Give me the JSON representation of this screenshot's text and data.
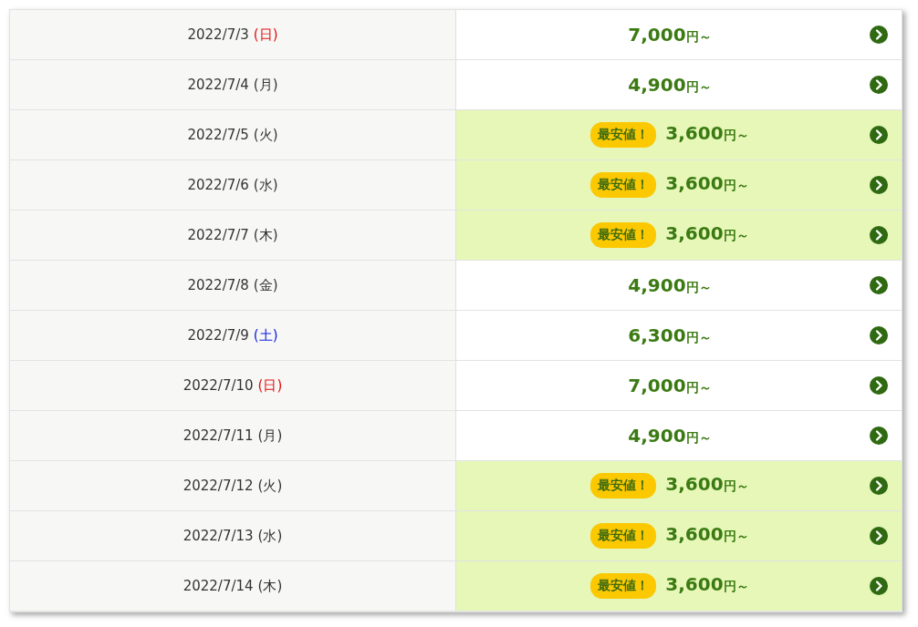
{
  "rows": [
    {
      "date": "2022/7/3",
      "weekday": "(日)",
      "color": "#e01010",
      "cheapest": false,
      "price": "7,000",
      "unit": "円～"
    },
    {
      "date": "2022/7/4",
      "weekday": "(月)",
      "color": "#333333",
      "cheapest": false,
      "price": "4,900",
      "unit": "円～"
    },
    {
      "date": "2022/7/5",
      "weekday": "(火)",
      "color": "#333333",
      "cheapest": true,
      "badge": "最安値！",
      "price": "3,600",
      "unit": "円～"
    },
    {
      "date": "2022/7/6",
      "weekday": "(水)",
      "color": "#333333",
      "cheapest": true,
      "badge": "最安値！",
      "price": "3,600",
      "unit": "円～"
    },
    {
      "date": "2022/7/7",
      "weekday": "(木)",
      "color": "#333333",
      "cheapest": true,
      "badge": "最安値！",
      "price": "3,600",
      "unit": "円～"
    },
    {
      "date": "2022/7/8",
      "weekday": "(金)",
      "color": "#333333",
      "cheapest": false,
      "price": "4,900",
      "unit": "円～"
    },
    {
      "date": "2022/7/9",
      "weekday": "(土)",
      "color": "#1020e0",
      "cheapest": false,
      "price": "6,300",
      "unit": "円～"
    },
    {
      "date": "2022/7/10",
      "weekday": "(日)",
      "color": "#e01010",
      "cheapest": false,
      "price": "7,000",
      "unit": "円～"
    },
    {
      "date": "2022/7/11",
      "weekday": "(月)",
      "color": "#333333",
      "cheapest": false,
      "price": "4,900",
      "unit": "円～"
    },
    {
      "date": "2022/7/12",
      "weekday": "(火)",
      "color": "#333333",
      "cheapest": true,
      "badge": "最安値！",
      "price": "3,600",
      "unit": "円～"
    },
    {
      "date": "2022/7/13",
      "weekday": "(水)",
      "color": "#333333",
      "cheapest": true,
      "badge": "最安値！",
      "price": "3,600",
      "unit": "円～"
    },
    {
      "date": "2022/7/14",
      "weekday": "(木)",
      "color": "#333333",
      "cheapest": true,
      "badge": "最安値！",
      "price": "3,600",
      "unit": "円～"
    }
  ]
}
